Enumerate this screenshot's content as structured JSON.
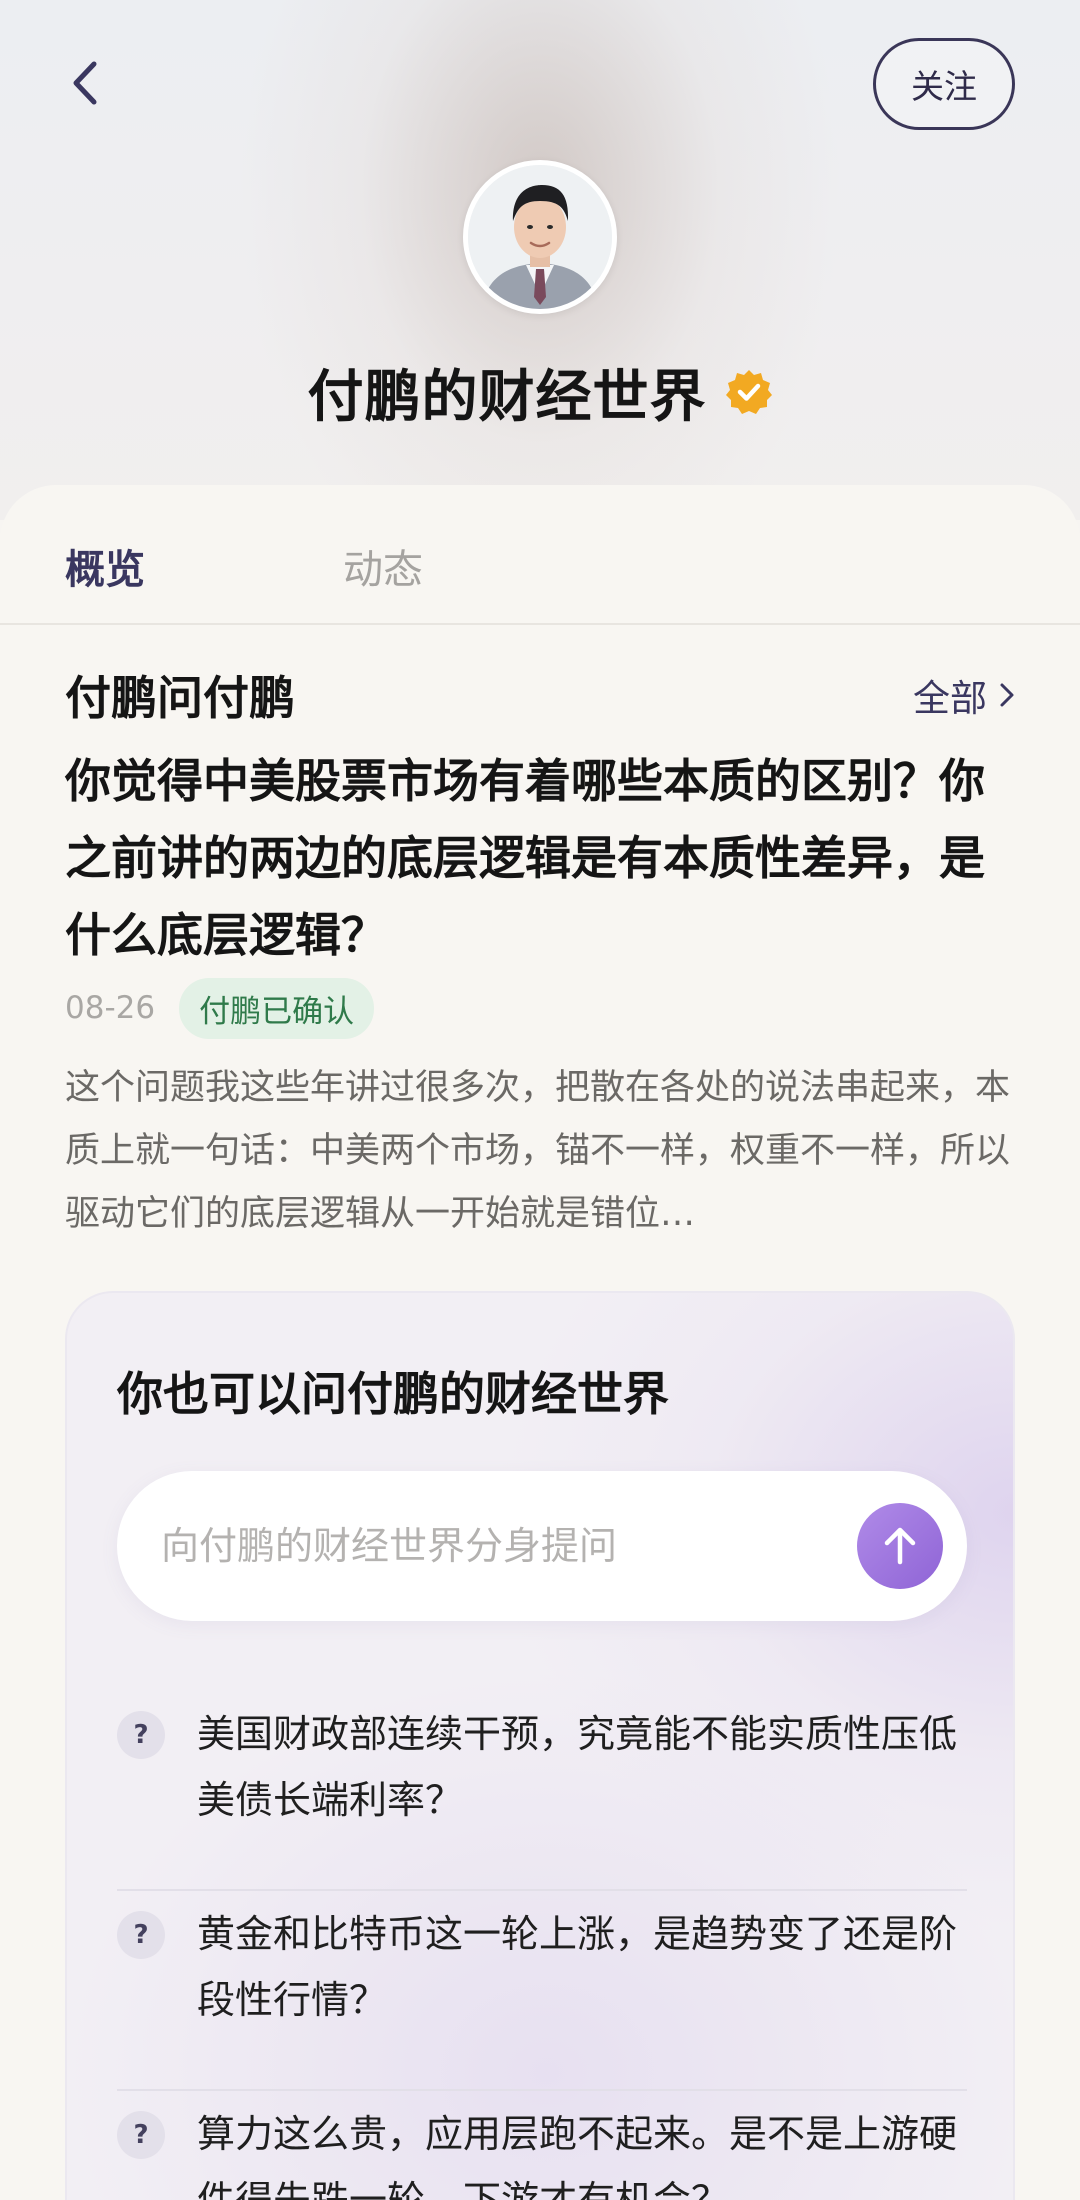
{
  "header": {
    "title": "付鹏的财经世界",
    "follow_label": "关注"
  },
  "tabs": [
    {
      "label": "概览",
      "active": true
    },
    {
      "label": "动态",
      "active": false
    }
  ],
  "qa_section": {
    "title": "付鹏问付鹏",
    "see_all": "全部",
    "question": "你觉得中美股票市场有着哪些本质的区别？你之前讲的两边的底层逻辑是有本质性差异，是什么底层逻辑？",
    "date": "08-26",
    "badge": "付鹏已确认",
    "answer_excerpt": "这个问题我这些年讲过很多次，把散在各处的说法串起来，本质上就一句话：中美两个市场，锚不一样，权重不一样，所以驱动它们的底层逻辑从一开始就是错位…"
  },
  "ask_card": {
    "title": "你也可以问付鹏的财经世界",
    "input_placeholder": "向付鹏的财经世界分身提问",
    "suggestions": [
      {
        "icon": "?",
        "text": "美国财政部连续干预，究竟能不能实质性压低美债长端利率？"
      },
      {
        "icon": "?",
        "text": "黄金和比特币这一轮上涨，是趋势变了还是阶段性行情？"
      },
      {
        "icon": "?",
        "text": "算力这么贵，应用层跑不起来。是不是上游硬件得先跌一轮，下游才有机会？"
      }
    ]
  },
  "colors": {
    "accent": "#3a3760",
    "send_button": "#9b72e0",
    "badge_bg": "#e3f1e6",
    "badge_text": "#2f7a4a",
    "verified": "#f2a922"
  },
  "icons": {
    "back": "chevron-left-icon",
    "verified": "verified-badge-icon",
    "see_all": "chevron-right-icon",
    "send": "arrow-up-icon",
    "suggestion": "question-mark-icon"
  }
}
